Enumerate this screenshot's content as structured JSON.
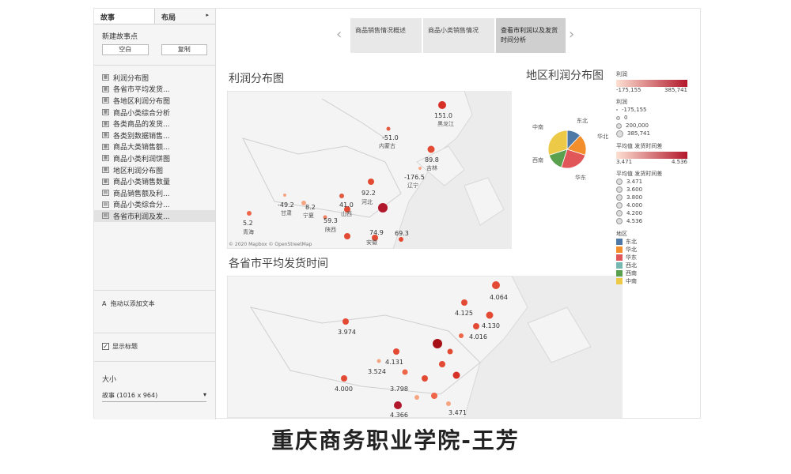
{
  "left_panel": {
    "tabs": [
      "故事",
      "布局"
    ],
    "new_story_point": "新建故事点",
    "buttons": [
      "空白",
      "复制"
    ],
    "story_items": [
      "利润分布图",
      "各省市平均发货...",
      "各地区利润分布图",
      "商品小类综合分析",
      "各类商品的发货...",
      "各类别数据销售...",
      "商品大类销售额...",
      "商品小类利润饼图",
      "地区利润分布图",
      "商品小类销售数量",
      "商品销售额及利...",
      "商品小类综合分...",
      "各省市利润及发..."
    ],
    "add_text": "拖动以添加文本",
    "show_title": "显示标题",
    "show_title_checked": "✓",
    "size_title": "大小",
    "size_value": "故事 (1016 x 964)",
    "size_arrow": "▾"
  },
  "navigator": {
    "prev": "‹",
    "next": "›",
    "points": [
      "商品销售情况概述",
      "商品小类销售情况",
      "查看市利润以及发货时间分析"
    ]
  },
  "profit_map": {
    "title": "利润分布图",
    "attribution": "© 2020 Mapbox © OpenStreetMap",
    "value_labels": [
      "151.0",
      "-51.0",
      "89.8",
      "-176.5",
      "92.2",
      "-49.2",
      "8.2",
      "41.0",
      "5.2",
      "59.3",
      "74.9",
      "69.3"
    ],
    "place_labels": [
      "黑龙江",
      "内蒙古",
      "吉林",
      "辽宁",
      "河北",
      "甘肃",
      "宁夏",
      "山西",
      "青海",
      "陕西",
      "安徽"
    ]
  },
  "ship_map": {
    "title": "各省市平均发货时间",
    "value_labels": [
      "4.064",
      "4.125",
      "4.130",
      "3.974",
      "4.016",
      "4.131",
      "3.524",
      "4.000",
      "3.798",
      "3.471",
      "4.366"
    ]
  },
  "pie": {
    "title": "地区利润分布图",
    "labels": [
      "东北",
      "华北",
      "华东",
      "西南",
      "中南"
    ],
    "values": [
      12,
      18,
      25,
      15,
      30
    ],
    "colors": [
      "#4e79a7",
      "#f28e2b",
      "#e15759",
      "#59a14f",
      "#edc948"
    ]
  },
  "legends": {
    "profit_title": "利润",
    "profit_range": [
      "-175,155",
      "385,741"
    ],
    "size_title": "利润",
    "size_items": [
      "-175,155",
      "0",
      "200,000",
      "385,741"
    ],
    "avg_title": "平均值 发货时间差",
    "avg_range": [
      "3.471",
      "4.536"
    ],
    "avg_size_title": "平均值 发货时间差",
    "avg_size_items": [
      "3.471",
      "3.600",
      "3.800",
      "4.000",
      "4.200",
      "4.536"
    ],
    "region_title": "地区",
    "regions": [
      "东北",
      "华北",
      "华东",
      "西北",
      "西南",
      "中南"
    ],
    "region_colors": [
      "#4e79a7",
      "#f28e2b",
      "#e15759",
      "#76b7b2",
      "#59a14f",
      "#edc948"
    ]
  },
  "caption": "重庆商务职业学院-王芳"
}
